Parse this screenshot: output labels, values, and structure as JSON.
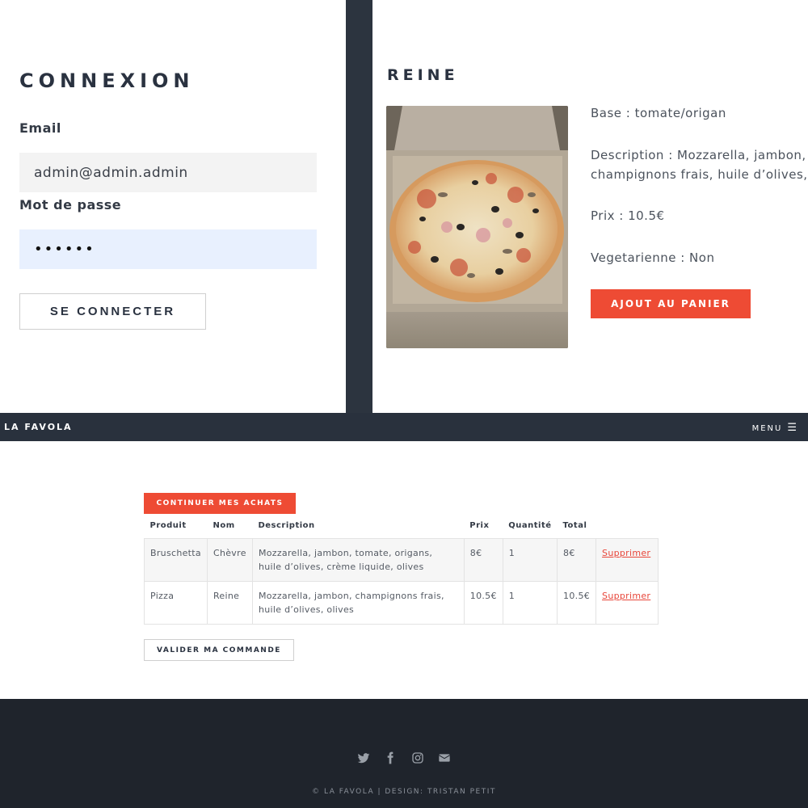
{
  "login": {
    "title": "CONNEXION",
    "email_label": "Email",
    "email_value": "admin@admin.admin",
    "password_label": "Mot de passe",
    "password_value": "••••••",
    "submit_label": "SE CONNECTER"
  },
  "product": {
    "title": "REINE",
    "base": "Base : tomate/origan",
    "description": "Description : Mozzarella, jambon, champignons frais, huile d’olives, o",
    "price": "Prix : 10.5€",
    "vegetarian": "Vegetarienne : Non",
    "add_to_cart_label": "AJOUT AU PANIER"
  },
  "navbar": {
    "brand": "LA FAVOLA",
    "menu_label": "MENU",
    "menu_icon": "hamburger-icon"
  },
  "cart": {
    "continue_label": "CONTINUER MES ACHATS",
    "headers": [
      "Produit",
      "Nom",
      "Description",
      "Prix",
      "Quantité",
      "Total",
      ""
    ],
    "rows": [
      {
        "product": "Bruschetta",
        "name": "Chèvre",
        "description": "Mozzarella, jambon, tomate, origans, huile d’olives, crème liquide, olives",
        "price": "8€",
        "quantity": "1",
        "total": "8€",
        "action": "Supprimer"
      },
      {
        "product": "Pizza",
        "name": "Reine",
        "description": "Mozzarella, jambon, champignons frais, huile d’olives, olives",
        "price": "10.5€",
        "quantity": "1",
        "total": "10.5€",
        "action": "Supprimer"
      }
    ],
    "validate_label": "VALIDER MA COMMANDE"
  },
  "footer": {
    "social_icons": [
      "twitter-icon",
      "facebook-icon",
      "instagram-icon",
      "envelope-icon"
    ],
    "copyright": "© LA FAVOLA | DESIGN: TRISTAN PETIT"
  },
  "colors": {
    "accent": "#ee4b34",
    "navbar": "#29313d",
    "footer": "#1f242c",
    "divider": "#2c343f"
  }
}
